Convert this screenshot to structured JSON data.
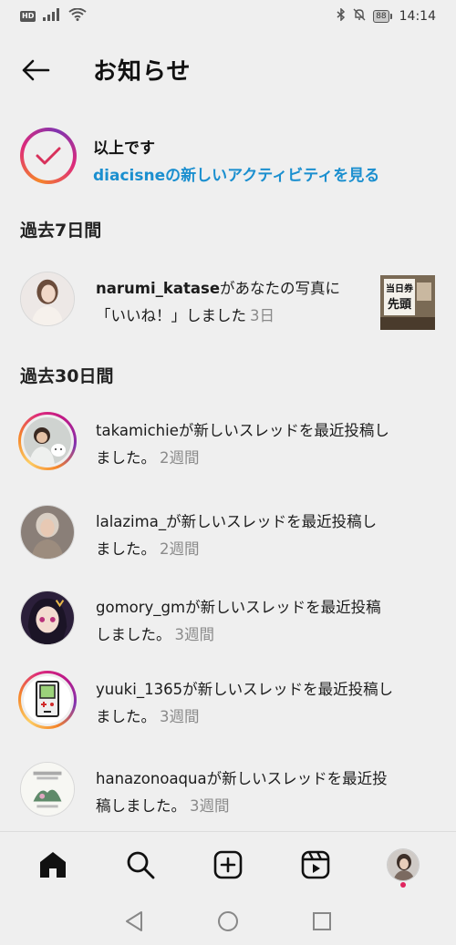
{
  "status_bar": {
    "hd_label": "HD",
    "battery": "88",
    "time": "14:14"
  },
  "header": {
    "title": "お知らせ",
    "back_icon": "arrow-left-icon"
  },
  "caught_up": {
    "title": "以上です",
    "link_user": "diacisne",
    "link_suffix": "の新しいアクティビティを見る",
    "gradient_colors": [
      "#f58529",
      "#dd2a7b",
      "#8134af"
    ]
  },
  "sections": {
    "week": {
      "label": "過去7日間"
    },
    "month": {
      "label": "過去30日間"
    }
  },
  "notifications_week": [
    {
      "username": "narumi_katase",
      "text_line1": "があなたの写真に",
      "text_line2": "「いいね！」しました",
      "time": "3日",
      "thumb_text_top": "当日券",
      "thumb_text_bottom": "先頭"
    }
  ],
  "notifications_month": [
    {
      "username": "takamichie",
      "text_a": "が新しいスレッドを最近投稿し",
      "text_b": "ました。",
      "time": "2週間",
      "ring": true
    },
    {
      "username": "lalazima_",
      "text_a": "が新しいスレッドを最近投稿し",
      "text_b": "ました。",
      "time": "2週間",
      "ring": false
    },
    {
      "username": "gomory_gm",
      "text_a": "が新しいスレッドを最近投稿",
      "text_b": "しました。",
      "time": "3週間",
      "ring": false
    },
    {
      "username": "yuuki_1365",
      "text_a": "が新しいスレッドを最近投稿し",
      "text_b": "ました。",
      "time": "3週間",
      "ring": true
    },
    {
      "username": "hanazonoaqua",
      "text_a": "が新しいスレッドを最近投",
      "text_b": "稿しました。",
      "time": "3週間",
      "ring": false
    }
  ],
  "bottom_nav": {
    "items": [
      "home-icon",
      "search-icon",
      "create-icon",
      "reels-icon",
      "profile-avatar"
    ],
    "notification_dot_color": "#e0245e"
  },
  "android_nav": {
    "items": [
      "back-triangle-icon",
      "home-circle-icon",
      "recents-square-icon"
    ]
  },
  "colors": {
    "background": "#efefef",
    "link": "#1b8fcf",
    "muted": "#8a8a8a"
  }
}
